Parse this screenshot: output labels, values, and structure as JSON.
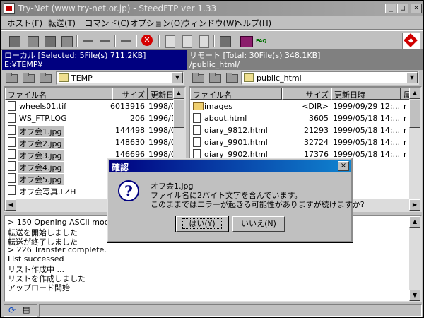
{
  "window": {
    "title": "Try-Net (www.try-net.or.jp) - SteedFTP ver 1.33",
    "minimize": "_",
    "maximize": "□",
    "close": "×"
  },
  "menu": [
    "ホスト(F)",
    "転送(T)",
    "コマンド(C)",
    "オプション(O)",
    "ウィンドウ(W)",
    "ヘルプ(H)"
  ],
  "toolbar": {
    "faq": "FAQ"
  },
  "local": {
    "status": "ローカル [Selected: 5File(s) 711.2KB]",
    "path": "E:¥TEMP¥",
    "dir": "TEMP",
    "headers": [
      "ファイル名",
      "サイズ",
      "更新日"
    ],
    "files": [
      {
        "name": "wheels01.tif",
        "size": "6013916",
        "date": "1998/0",
        "selected": false
      },
      {
        "name": "WS_FTP.LOG",
        "size": "206",
        "date": "1996/1",
        "selected": false
      },
      {
        "name": "オフ会1.jpg",
        "size": "144498",
        "date": "1998/0",
        "selected": true
      },
      {
        "name": "オフ会2.jpg",
        "size": "148630",
        "date": "1998/0",
        "selected": true
      },
      {
        "name": "オフ会3.jpg",
        "size": "146696",
        "date": "1998/0",
        "selected": true
      },
      {
        "name": "オフ会4.jpg",
        "size": "",
        "date": "",
        "selected": true
      },
      {
        "name": "オフ会5.jpg",
        "size": "",
        "date": "",
        "selected": true
      },
      {
        "name": "オフ会写真.LZH",
        "size": "",
        "date": "",
        "selected": false
      }
    ]
  },
  "remote": {
    "status": "リモート [Total: 30File(s) 348.1KB]",
    "path": "/public_html/",
    "dir": "public_html",
    "headers": [
      "ファイル名",
      "サイズ",
      "更新日時",
      "属"
    ],
    "files": [
      {
        "name": "images",
        "size": "<DIR>",
        "date": "1999/09/29 12:...",
        "attr": "r",
        "folder": true
      },
      {
        "name": "about.html",
        "size": "3605",
        "date": "1999/05/18 14:...",
        "attr": "r",
        "folder": false
      },
      {
        "name": "diary_9812.html",
        "size": "21293",
        "date": "1999/05/18 14:...",
        "attr": "r",
        "folder": false
      },
      {
        "name": "diary_9901.html",
        "size": "32724",
        "date": "1999/05/18 14:...",
        "attr": "r",
        "folder": false
      },
      {
        "name": "diary_9902.html",
        "size": "17376",
        "date": "1999/05/18 14:...",
        "attr": "r",
        "folder": false
      }
    ]
  },
  "log": [
    "> 150 Opening ASCII mode d",
    "転送を開始しました",
    "転送が終了しました",
    "> 226 Transfer complete.",
    "List successed",
    "リスト作成中 ...",
    "リストを作成しました",
    "アップロード開始"
  ],
  "dialog": {
    "title": "確認",
    "close": "×",
    "icon": "?",
    "line1": "オフ会1.jpg",
    "line2": "ファイル名に2バイト文字を含んでいます。",
    "line3": "このままではエラーが起きる可能性がありますが続けますか?",
    "yes": "はい(Y)",
    "no": "いいえ(N)"
  }
}
